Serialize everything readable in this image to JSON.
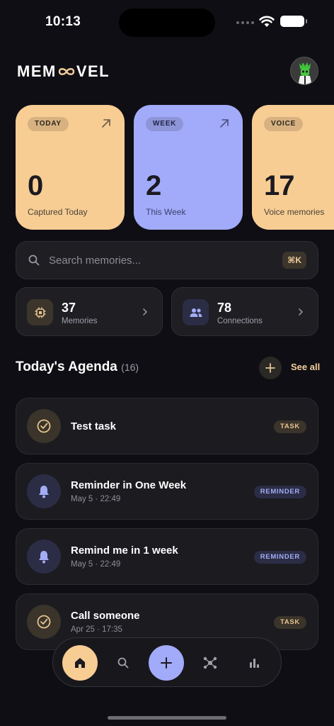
{
  "status_bar": {
    "time": "10:13"
  },
  "header": {
    "logo_left": "MEM",
    "logo_right": "VEL",
    "logo_icon": "infinity-icon",
    "avatar_icon": "user-avatar"
  },
  "stat_cards": [
    {
      "tag": "TODAY",
      "value": "0",
      "label": "Captured Today",
      "color": "#f7cd94"
    },
    {
      "tag": "WEEK",
      "value": "2",
      "label": "This Week",
      "color": "#a2abf9"
    },
    {
      "tag": "VOICE",
      "value": "17",
      "label": "Voice memories",
      "color": "#f7cd94"
    }
  ],
  "search": {
    "placeholder": "Search memories...",
    "shortcut": "⌘K"
  },
  "tiles": [
    {
      "value": "37",
      "label": "Memories",
      "icon": "chip-icon"
    },
    {
      "value": "78",
      "label": "Connections",
      "icon": "people-icon"
    }
  ],
  "agenda": {
    "title": "Today's Agenda",
    "count": "(16)",
    "see_all": "See all",
    "items": [
      {
        "title": "Test task",
        "subtitle": "",
        "badge": "TASK",
        "icon": "check-circle-icon"
      },
      {
        "title": "Reminder in One Week",
        "subtitle": "May 5 · 22:49",
        "badge": "REMINDER",
        "icon": "bell-icon"
      },
      {
        "title": "Remind me in 1 week",
        "subtitle": "May 5 · 22:49",
        "badge": "REMINDER",
        "icon": "bell-icon"
      },
      {
        "title": "Call someone",
        "subtitle": "Apr 25 · 17:35",
        "badge": "TASK",
        "icon": "check-circle-icon"
      }
    ]
  },
  "nav": {
    "items": [
      "home-icon",
      "search-icon",
      "plus-icon",
      "graph-icon",
      "chart-icon"
    ],
    "active": "home-icon"
  },
  "colors": {
    "background": "#0f0e14",
    "accent_peach": "#f7cd94",
    "accent_lavender": "#a2abf9"
  }
}
